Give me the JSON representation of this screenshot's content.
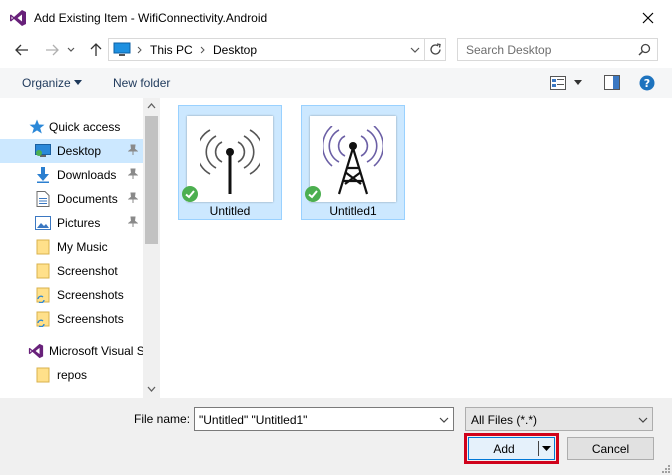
{
  "window": {
    "title": "Add Existing Item - WifiConnectivity.Android"
  },
  "address": {
    "crumbs": [
      "This PC",
      "Desktop"
    ]
  },
  "search": {
    "placeholder": "Search Desktop"
  },
  "toolbar": {
    "organize_label": "Organize",
    "new_folder_label": "New folder"
  },
  "sidebar": {
    "quick_access": "Quick access",
    "items": [
      {
        "label": "Desktop",
        "icon": "desktop-icon",
        "pinned": true,
        "selected": true
      },
      {
        "label": "Downloads",
        "icon": "downloads-icon",
        "pinned": true
      },
      {
        "label": "Documents",
        "icon": "documents-icon",
        "pinned": true
      },
      {
        "label": "Pictures",
        "icon": "pictures-icon",
        "pinned": true
      },
      {
        "label": "My Music",
        "icon": "folder-icon"
      },
      {
        "label": "Screenshot",
        "icon": "folder-icon"
      },
      {
        "label": "Screenshots",
        "icon": "folder-icon"
      },
      {
        "label": "Screenshots",
        "icon": "folder-icon"
      }
    ],
    "vs_label": "Microsoft Visual S",
    "repos_label": "repos"
  },
  "files": [
    {
      "name": "Untitled",
      "icon": "wifi-antenna-icon",
      "synced": true
    },
    {
      "name": "Untitled1",
      "icon": "cell-tower-icon",
      "synced": true
    }
  ],
  "bottom": {
    "file_name_label": "File name:",
    "file_name_value": "\"Untitled\" \"Untitled1\"",
    "filter_value": "All Files (*.*)",
    "add_label": "Add",
    "cancel_label": "Cancel"
  },
  "colors": {
    "selection": "#cce8ff",
    "accent": "#0078d7",
    "highlight": "#d0021b",
    "vs_purple": "#68217a"
  }
}
